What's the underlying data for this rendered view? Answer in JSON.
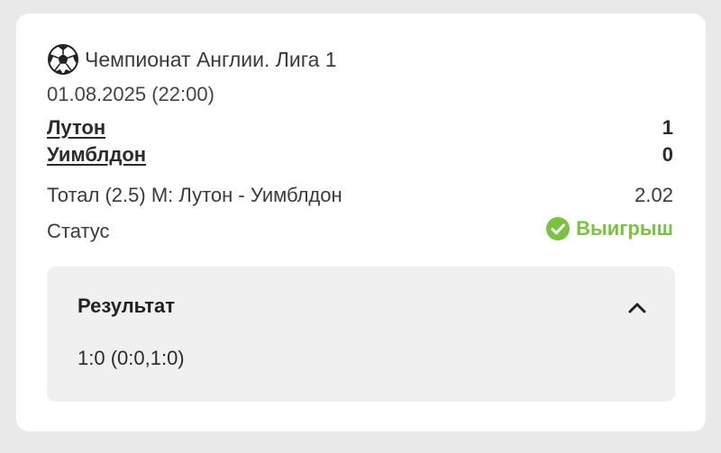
{
  "colors": {
    "background": "#e9e9e9",
    "card": "#ffffff",
    "panel": "#f0f0f0",
    "text": "#2b2b2b",
    "win_green": "#7cc242"
  },
  "event": {
    "sport_icon": "soccer-ball-icon",
    "league": "Чемпионат Англии. Лига 1",
    "datetime": "01.08.2025 (22:00)",
    "team1": "Лутон",
    "team2": "Уимблдон",
    "score1": "1",
    "score2": "0"
  },
  "bet": {
    "description": "Тотал (2.5) М: Лутон - Уимблдон",
    "odds": "2.02",
    "status_label": "Статус",
    "status_value": "Выигрыш",
    "status_icon": "check-circle-icon"
  },
  "result": {
    "title": "Результат",
    "value": "1:0 (0:0,1:0)",
    "toggle_icon": "chevron-up-icon",
    "expanded": true
  }
}
